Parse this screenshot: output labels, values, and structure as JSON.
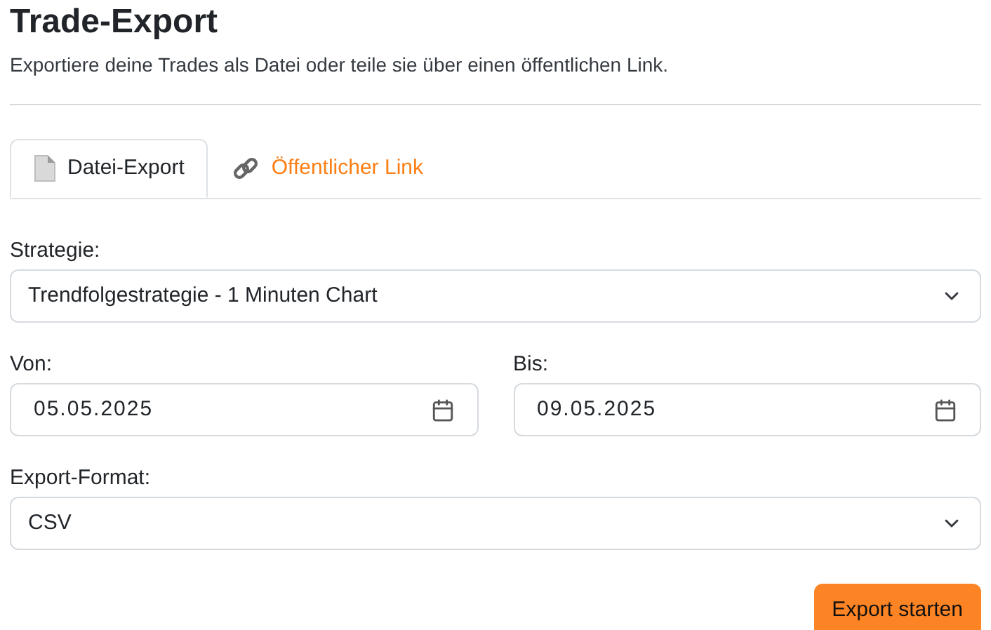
{
  "title": "Trade-Export",
  "subtitle": "Exportiere deine Trades als Datei oder teile sie über einen öffentlichen Link.",
  "tabs": [
    {
      "kind": "file",
      "label": "Datei-Export",
      "selected": true
    },
    {
      "kind": "link",
      "label": "Öffentlicher Link",
      "selected": false
    }
  ],
  "strategy": {
    "label": "Strategie:",
    "value": "Trendfolgestrategie - 1 Minuten Chart"
  },
  "from": {
    "label": "Von:",
    "value": "05.05.2025"
  },
  "to": {
    "label": "Bis:",
    "value": "09.05.2025"
  },
  "format": {
    "label": "Export-Format:",
    "value": "CSV"
  },
  "button": "Export starten"
}
